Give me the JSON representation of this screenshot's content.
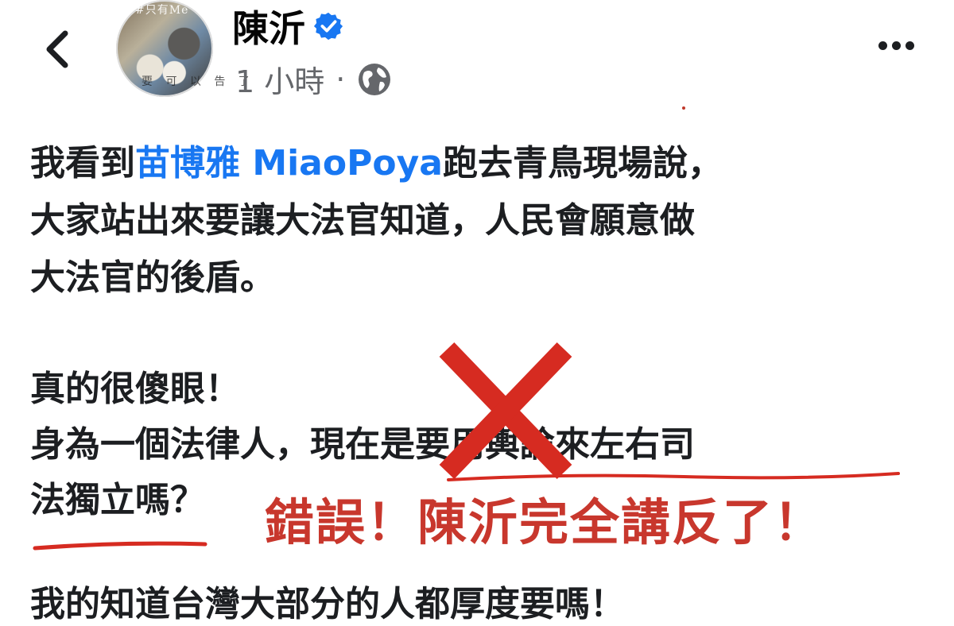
{
  "header": {
    "back_icon": "chevron-left-icon",
    "avatar_caption_top": "#只有Me",
    "avatar_caption_bottom": "要 可 以 告 了",
    "author_name": "陳沂",
    "verified_icon": "verified-badge-icon",
    "time": "1 小時",
    "separator": "·",
    "privacy_icon": "globe-icon",
    "more_icon": "more-horizontal-icon"
  },
  "post": {
    "line1_before": "我看到",
    "mention": "苗博雅 MiaoPoya",
    "line1_after": "跑去青鳥現場說，",
    "line2": "大家站出來要讓大法官知道，人民會願意做",
    "line3": "大法官的後盾。",
    "line4": "真的很傻眼！",
    "line5": "身為一個法律人，現在是要用輿論來左右司",
    "line6": "法獨立嗎？",
    "line7_partial": "我的知道台灣大部分的人都厚度要嗎！"
  },
  "annotation": {
    "text": "錯誤！陳沂完全講反了！",
    "color": "#c8372d",
    "mark_icon": "red-x-mark-icon"
  },
  "colors": {
    "mention": "#1877f2",
    "secondary_text": "#65676b",
    "annotation_red": "#c8372d"
  }
}
